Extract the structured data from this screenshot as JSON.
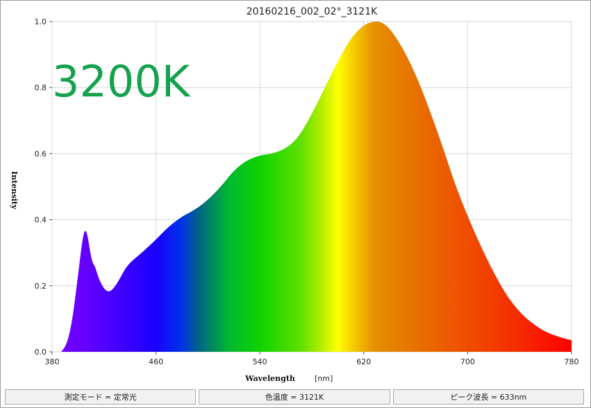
{
  "chart_data": {
    "type": "area",
    "title": "20160216_002_02°_3121K",
    "annotation": "3200K",
    "xlabel": "Wavelength",
    "xunit": "[nm]",
    "ylabel": "Intensity",
    "xlim": [
      380,
      780
    ],
    "ylim": [
      0,
      1.0
    ],
    "xticks": [
      380,
      460,
      540,
      620,
      700,
      780
    ],
    "xtick_labels": [
      "380",
      "460",
      "540",
      "620",
      "700",
      "780"
    ],
    "yticks": [
      0.0,
      0.2,
      0.4,
      0.6,
      0.8,
      1.0
    ],
    "ytick_labels": [
      "0.0",
      "0.2",
      "0.4",
      "0.6",
      "0.8",
      "1.0"
    ],
    "grid": true,
    "series": [
      {
        "x": [
          387,
          391,
          395,
          399,
          403,
          405,
          407,
          409,
          411,
          413,
          416,
          420,
          424,
          428,
          432,
          436,
          440,
          446,
          452,
          460,
          470,
          480,
          490,
          500,
          510,
          520,
          530,
          540,
          550,
          560,
          570,
          580,
          590,
          600,
          610,
          620,
          627,
          633,
          640,
          650,
          660,
          670,
          680,
          690,
          700,
          710,
          720,
          730,
          740,
          750,
          760,
          770,
          780
        ],
        "y": [
          0.0,
          0.02,
          0.08,
          0.2,
          0.33,
          0.37,
          0.36,
          0.31,
          0.27,
          0.26,
          0.22,
          0.19,
          0.18,
          0.195,
          0.22,
          0.25,
          0.27,
          0.29,
          0.31,
          0.34,
          0.38,
          0.41,
          0.43,
          0.46,
          0.5,
          0.55,
          0.58,
          0.595,
          0.6,
          0.615,
          0.65,
          0.72,
          0.8,
          0.88,
          0.95,
          0.99,
          1.0,
          1.0,
          0.98,
          0.92,
          0.84,
          0.74,
          0.63,
          0.51,
          0.41,
          0.32,
          0.24,
          0.17,
          0.12,
          0.085,
          0.06,
          0.045,
          0.035
        ]
      }
    ]
  },
  "status_bar": {
    "mode": "測定モード = 定常光",
    "color_temp": "色温度 = 3121K",
    "peak": "ピーク波長 = 633nm"
  },
  "colors": {
    "annotation": "#14a24e",
    "grid": "#d6d6d6",
    "frame": "#9a9a9a"
  }
}
